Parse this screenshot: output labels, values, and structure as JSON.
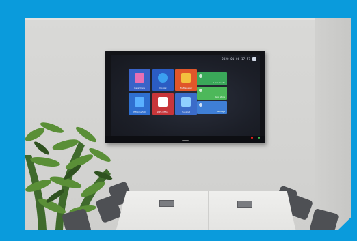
{
  "screen": {
    "clock_text": "2020-01-06 17:57",
    "apps": [
      {
        "label": "InstaShare",
        "bg": "#3a63c8",
        "icon_color": "#e86fb3"
      },
      {
        "label": "Droplet",
        "bg": "#2b5cc3",
        "icon_color": "#3ba0f0"
      },
      {
        "label": "FileManager",
        "bg": "#e0562a",
        "icon_color": "#f3c03e"
      },
      {
        "label": "EZWrite 5.0",
        "bg": "#2f6fd0",
        "icon_color": "#5ab0ff"
      },
      {
        "label": "WPS Office",
        "bg": "#c8363a",
        "icon_color": "#ffffff"
      },
      {
        "label": "Support",
        "bg": "#3b6cc9",
        "icon_color": "#8fd0ff"
      }
    ],
    "widgets": [
      {
        "label": "User Guide",
        "bg": "#3aa859"
      },
      {
        "label": "App Store",
        "bg": "#4db85a"
      },
      {
        "label": "Settings",
        "bg": "#3f7fd6"
      }
    ]
  },
  "colors": {
    "border_blue": "#0a9bdc",
    "led_red": "#e0201c",
    "led_green": "#3bbd55"
  }
}
